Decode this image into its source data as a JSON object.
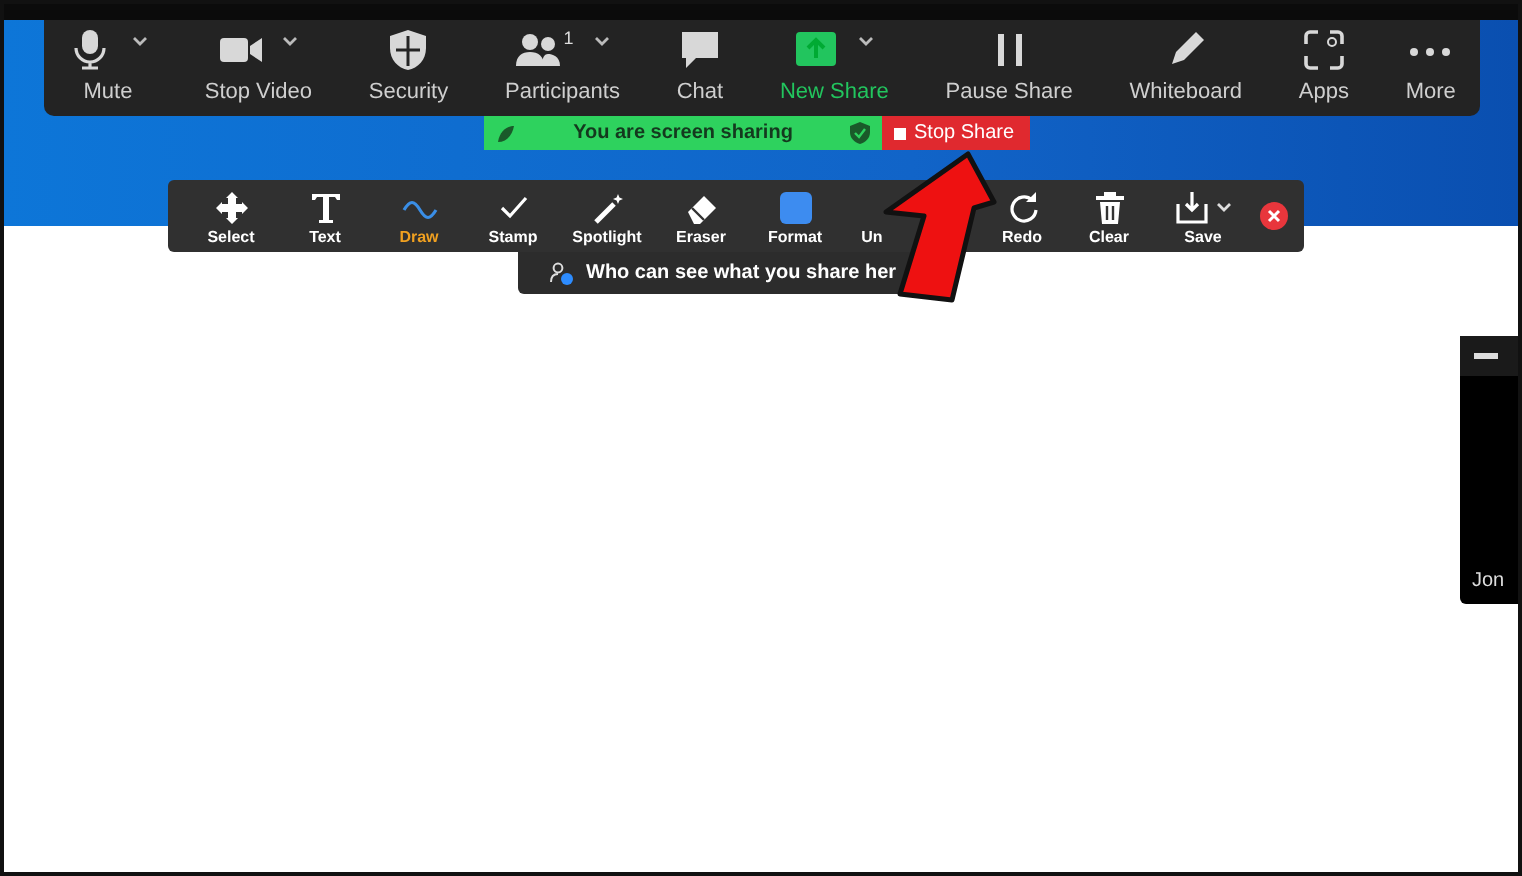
{
  "meeting_toolbar": {
    "items": [
      {
        "label": "Mute",
        "has_menu": true,
        "highlighted": false
      },
      {
        "label": "Stop Video",
        "has_menu": true,
        "highlighted": false
      },
      {
        "label": "Security",
        "has_menu": false,
        "highlighted": false
      },
      {
        "label": "Participants",
        "badge": "1",
        "has_menu": true,
        "highlighted": false
      },
      {
        "label": "Chat",
        "has_menu": false,
        "highlighted": false
      },
      {
        "label": "New Share",
        "has_menu": true,
        "highlighted": true
      },
      {
        "label": "Pause Share",
        "has_menu": false,
        "highlighted": false
      },
      {
        "label": "Whiteboard",
        "has_menu": false,
        "highlighted": false
      },
      {
        "label": "Apps",
        "has_menu": false,
        "highlighted": false
      },
      {
        "label": "More",
        "has_menu": false,
        "highlighted": false
      }
    ]
  },
  "share_bar": {
    "status": "You are screen sharing",
    "stop_button": "Stop Share"
  },
  "annotation_toolbar": {
    "tools": [
      {
        "label": "Select",
        "selected": false,
        "has_menu": false
      },
      {
        "label": "Text",
        "selected": false,
        "has_menu": false
      },
      {
        "label": "Draw",
        "selected": true,
        "has_menu": false
      },
      {
        "label": "Stamp",
        "selected": false,
        "has_menu": false
      },
      {
        "label": "Spotlight",
        "selected": false,
        "has_menu": false
      },
      {
        "label": "Eraser",
        "selected": false,
        "has_menu": false
      },
      {
        "label": "Format",
        "selected": false,
        "has_menu": false
      },
      {
        "label": "Un",
        "selected": false,
        "has_menu": false
      },
      {
        "label": "Redo",
        "selected": false,
        "has_menu": false
      },
      {
        "label": "Clear",
        "selected": false,
        "has_menu": false
      },
      {
        "label": "Save",
        "selected": false,
        "has_menu": true
      }
    ]
  },
  "tooltip": {
    "text": "Who can see what you share her"
  },
  "video_thumbnail": {
    "name": "Jon"
  }
}
